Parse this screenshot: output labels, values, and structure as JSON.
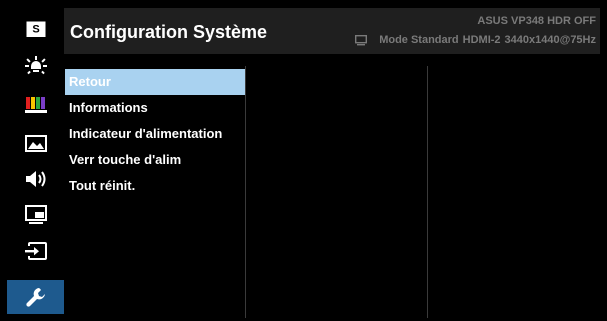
{
  "header": {
    "title": "Configuration Système",
    "model": "ASUS  VP348 HDR OFF",
    "mode": "Mode Standard",
    "input": "HDMI-2",
    "resolution": "3440x1440@75Hz"
  },
  "sidebar": {
    "items": [
      {
        "name": "splendid",
        "icon": "s-badge-icon",
        "selected": false
      },
      {
        "name": "blue-light-filter",
        "icon": "brightness-icon",
        "selected": false
      },
      {
        "name": "color",
        "icon": "color-bars-icon",
        "selected": false
      },
      {
        "name": "image",
        "icon": "image-icon",
        "selected": false
      },
      {
        "name": "sound",
        "icon": "speaker-icon",
        "selected": false
      },
      {
        "name": "pip-pbp",
        "icon": "pip-icon",
        "selected": false
      },
      {
        "name": "input-select",
        "icon": "input-icon",
        "selected": false
      },
      {
        "name": "system-setup",
        "icon": "wrench-icon",
        "selected": true
      }
    ]
  },
  "menu": {
    "items": [
      {
        "label": "Retour",
        "selected": true
      },
      {
        "label": "Informations",
        "selected": false
      },
      {
        "label": "Indicateur d'alimentation",
        "selected": false
      },
      {
        "label": "Verr touche d'alim",
        "selected": false
      },
      {
        "label": "Tout réinit.",
        "selected": false
      }
    ]
  },
  "colors": {
    "active_tab": "#1e5a8e",
    "selected_item": "#a9d2f0",
    "header_bg": "#1f1f1f",
    "header_text": "#7a7a7a"
  }
}
